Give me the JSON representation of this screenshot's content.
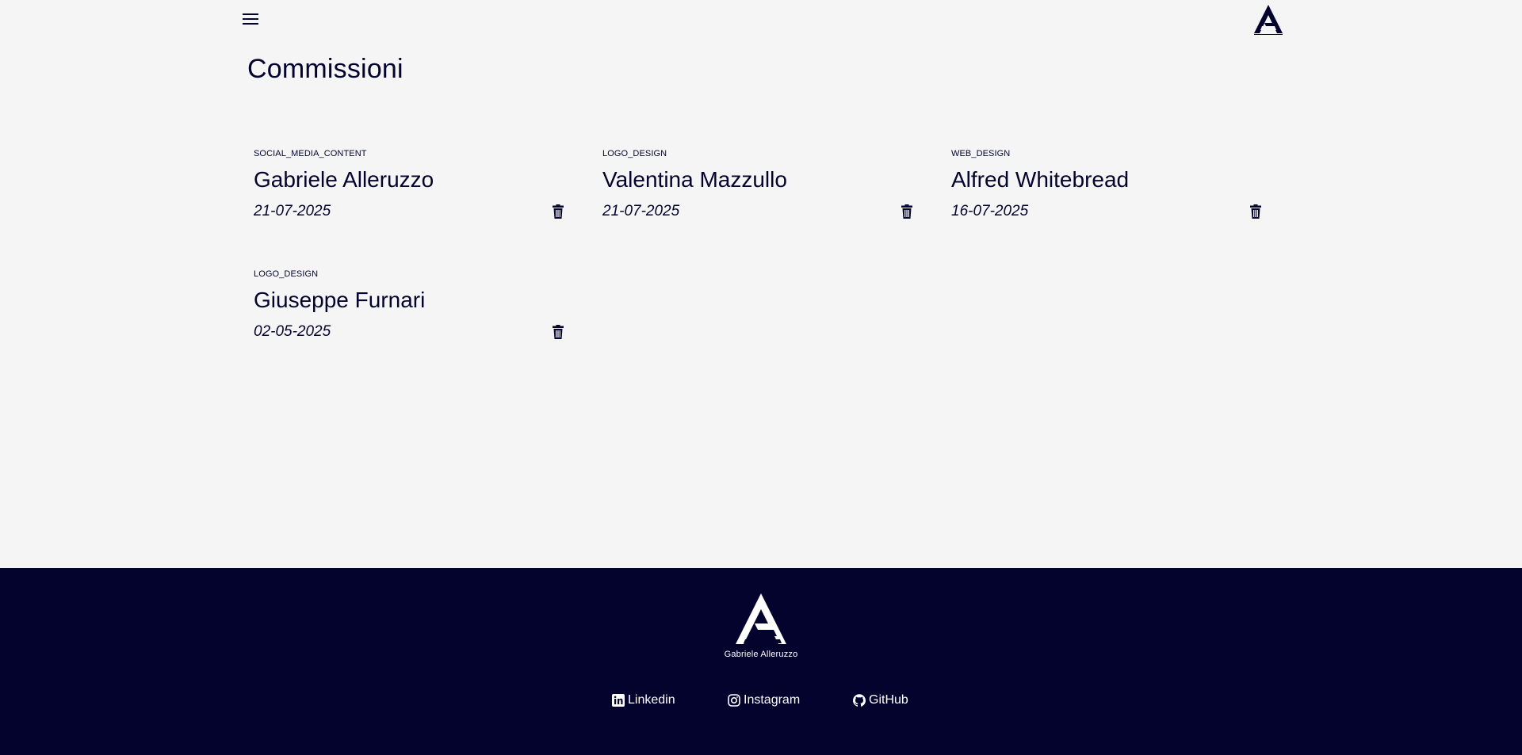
{
  "page": {
    "title": "Commissioni"
  },
  "header": {
    "menu_icon": "hamburger-menu-icon",
    "logo": "ag-monogram-logo"
  },
  "commissions": [
    {
      "type": "SOCIAL_MEDIA_CONTENT",
      "name": "Gabriele Alleruzzo",
      "date": "21-07-2025",
      "action_icon": "trash-icon"
    },
    {
      "type": "LOGO_DESIGN",
      "name": "Valentina Mazzullo",
      "date": "21-07-2025",
      "action_icon": "trash-icon"
    },
    {
      "type": "WEB_DESIGN",
      "name": "Alfred Whitebread",
      "date": "16-07-2025",
      "action_icon": "trash-icon"
    },
    {
      "type": "LOGO_DESIGN",
      "name": "Giuseppe Furnari",
      "date": "02-05-2025",
      "action_icon": "trash-icon"
    }
  ],
  "footer": {
    "brand": "Gabriele Alleruzzo",
    "links": [
      {
        "label": "Linkedin",
        "icon": "linkedin-icon"
      },
      {
        "label": "Instagram",
        "icon": "instagram-icon"
      },
      {
        "label": "GitHub",
        "icon": "github-icon"
      }
    ]
  },
  "colors": {
    "background": "#f5f5f5",
    "primary": "#03032e",
    "footer_text": "#ffffff"
  }
}
